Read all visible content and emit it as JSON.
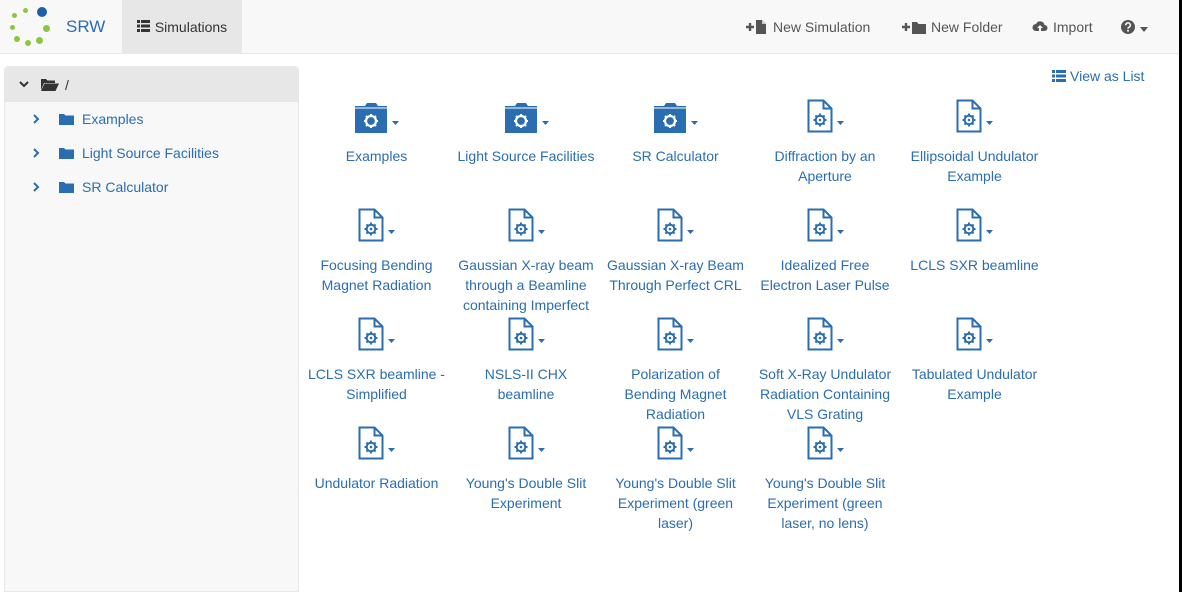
{
  "brand": {
    "name": "SRW",
    "colors": {
      "blue": "#1f5ea8",
      "green": "#8cc63f"
    }
  },
  "nav": {
    "simulations_label": "Simulations",
    "new_simulation_label": "New Simulation",
    "new_folder_label": "New Folder",
    "import_label": "Import",
    "help_icon": "question-circle-icon"
  },
  "sidebar": {
    "root_label": "/",
    "items": [
      {
        "label": "Examples"
      },
      {
        "label": "Light Source Facilities"
      },
      {
        "label": "SR Calculator"
      }
    ]
  },
  "main": {
    "view_as_list_label": "View as List",
    "folders": [
      {
        "label": "Examples"
      },
      {
        "label": "Light Source Facilities"
      },
      {
        "label": "SR Calculator"
      }
    ],
    "simulations": [
      {
        "label": "Diffraction by an Aperture"
      },
      {
        "label": "Ellipsoidal Undulator Example"
      },
      {
        "label": "Focusing Bending Magnet Radiation"
      },
      {
        "label": "Gaussian X-ray beam through a Beamline containing Imperfect"
      },
      {
        "label": "Gaussian X-ray Beam Through Perfect CRL"
      },
      {
        "label": "Idealized Free Electron Laser Pulse"
      },
      {
        "label": "LCLS SXR beamline"
      },
      {
        "label": "LCLS SXR beamline - Simplified"
      },
      {
        "label": "NSLS-II CHX beamline"
      },
      {
        "label": "Polarization of Bending Magnet Radiation"
      },
      {
        "label": "Soft X-Ray Undulator Radiation Containing VLS Grating"
      },
      {
        "label": "Tabulated Undulator Example"
      },
      {
        "label": "Undulator Radiation"
      },
      {
        "label": "Young's Double Slit Experiment"
      },
      {
        "label": "Young's Double Slit Experiment (green laser)"
      },
      {
        "label": "Young's Double Slit Experiment (green laser, no lens)"
      }
    ]
  },
  "colors": {
    "link": "#2a6db0",
    "navbar_bg": "#f8f8f8",
    "active_nav_bg": "#e7e7e7"
  }
}
